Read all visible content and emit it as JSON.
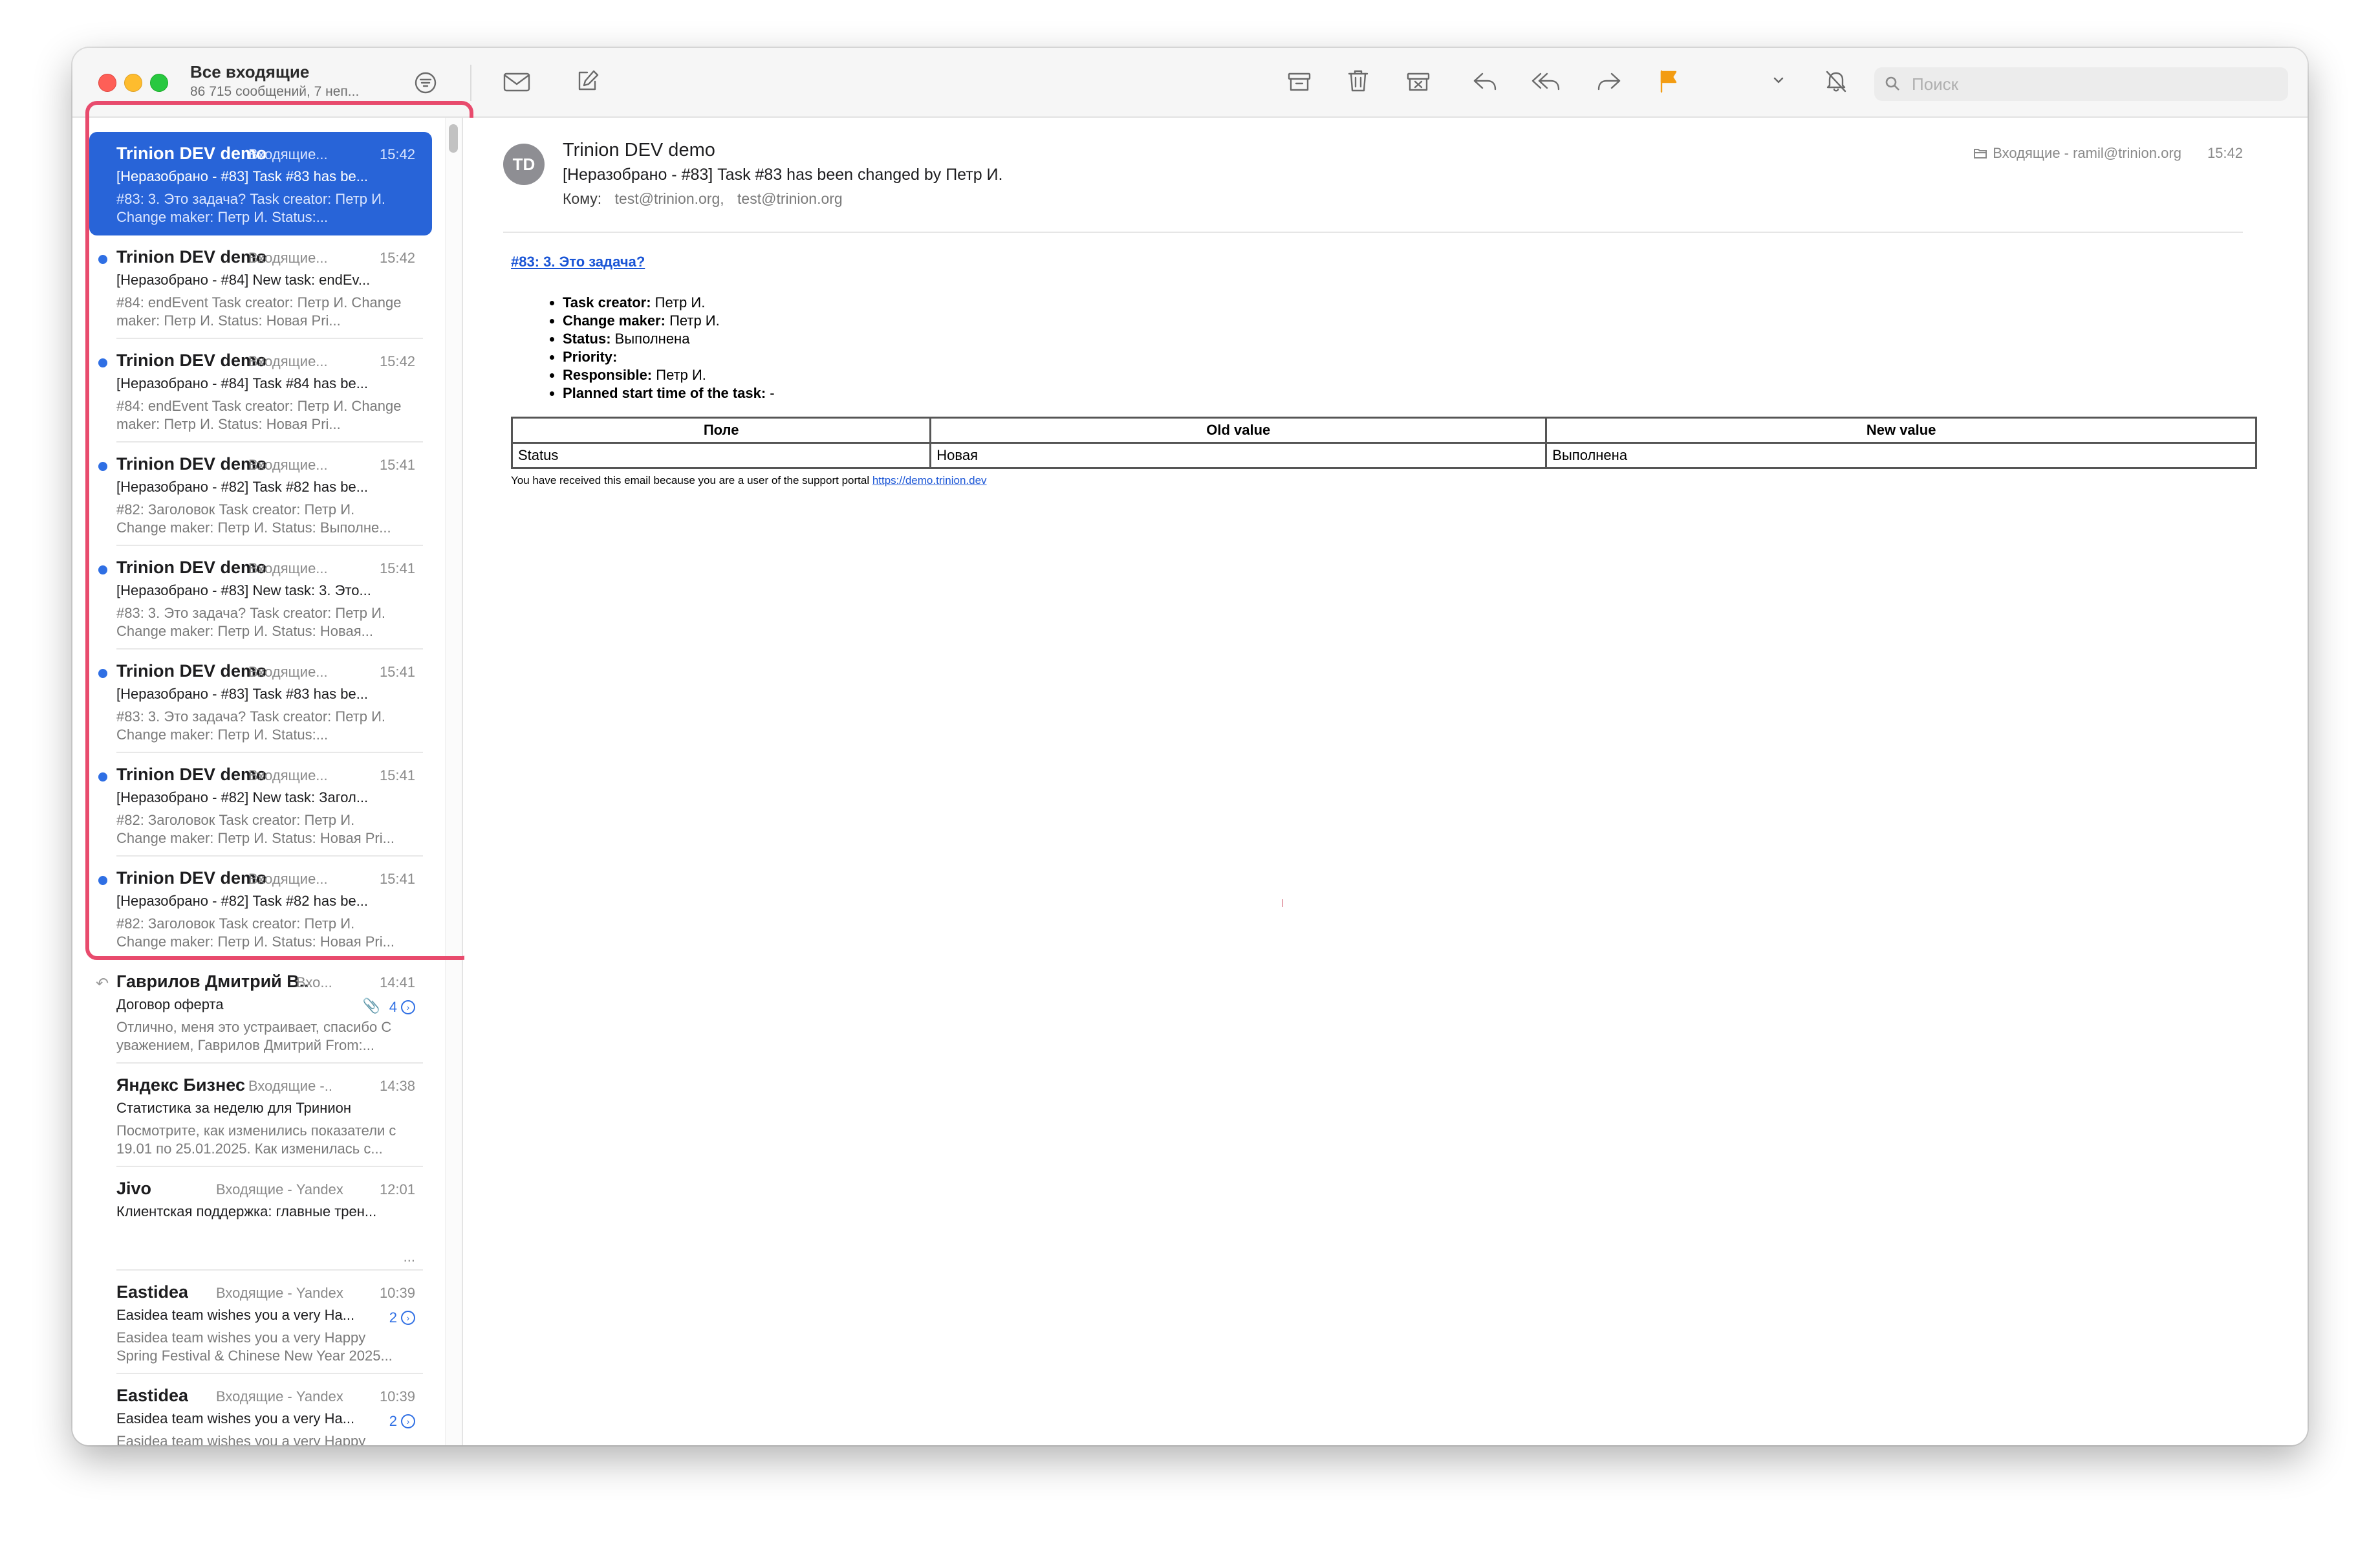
{
  "window": {
    "mailbox_title": "Все входящие",
    "mailbox_subtitle": "86 715 сообщений, 7 неп..."
  },
  "toolbar": {
    "icons": [
      "filter-icon",
      "envelope-icon",
      "compose-icon",
      "archive-icon",
      "trash-icon",
      "junk-icon",
      "reply-icon",
      "reply-all-icon",
      "forward-icon",
      "flag-icon",
      "mute-icon",
      "move-folder-icon",
      "search-icon"
    ],
    "flag_color": "#f39c12",
    "search_placeholder": "Поиск"
  },
  "messages": [
    {
      "from": "Trinion DEV demo",
      "mailbox": "Входящие...",
      "time": "15:42",
      "subject": "[Неразобрано -  #83] Task #83 has be...",
      "preview": "#83: 3. Это задача? Task creator: Петр И. Change maker: Петр И. Status:...",
      "unread": false,
      "selected": true
    },
    {
      "from": "Trinion DEV demo",
      "mailbox": "Входящие...",
      "time": "15:42",
      "subject": "[Неразобрано -  #84] New task: endEv...",
      "preview": "#84: endEvent Task creator: Петр И. Change maker: Петр И. Status: Новая Pri...",
      "unread": true,
      "selected": false
    },
    {
      "from": "Trinion DEV demo",
      "mailbox": "Входящие...",
      "time": "15:42",
      "subject": "[Неразобрано -  #84] Task #84 has be...",
      "preview": "#84: endEvent Task creator: Петр И. Change maker: Петр И. Status: Новая Pri...",
      "unread": true,
      "selected": false
    },
    {
      "from": "Trinion DEV demo",
      "mailbox": "Входящие...",
      "time": "15:41",
      "subject": "[Неразобрано -  #82] Task #82 has be...",
      "preview": "#82: Заголовок Task creator: Петр И. Change maker: Петр И. Status: Выполне...",
      "unread": true,
      "selected": false
    },
    {
      "from": "Trinion DEV demo",
      "mailbox": "Входящие...",
      "time": "15:41",
      "subject": "[Неразобрано -  #83] New task: 3. Это...",
      "preview": "#83: 3. Это задача? Task creator: Петр И. Change maker: Петр И. Status: Новая...",
      "unread": true,
      "selected": false
    },
    {
      "from": "Trinion DEV demo",
      "mailbox": "Входящие...",
      "time": "15:41",
      "subject": "[Неразобрано -  #83] Task #83 has be...",
      "preview": "#83: 3. Это задача? Task creator: Петр И. Change maker: Петр И. Status:...",
      "unread": true,
      "selected": false
    },
    {
      "from": "Trinion DEV demo",
      "mailbox": "Входящие...",
      "time": "15:41",
      "subject": "[Неразобрано -  #82] New task: Загол...",
      "preview": "#82: Заголовок Task creator: Петр И. Change maker: Петр И. Status: Новая Pri...",
      "unread": true,
      "selected": false
    },
    {
      "from": "Trinion DEV demo",
      "mailbox": "Входящие...",
      "time": "15:41",
      "subject": "[Неразобрано -  #82] Task #82 has be...",
      "preview": "#82: Заголовок Task creator: Петр И. Change maker: Петр И. Status: Новая Pri...",
      "unread": true,
      "selected": false
    },
    {
      "from": "Гаврилов Дмитрий В...",
      "mailbox": "Вхо...",
      "time": "14:41",
      "subject": "Договор оферта",
      "preview": "Отлично, меня это устраивает, спасибо С уважением, Гаврилов Дмитрий From:...",
      "unread": false,
      "selected": false,
      "replied": true,
      "attachment": true,
      "thread_count": "4"
    },
    {
      "from": "Яндекс Бизнес",
      "mailbox": "Входящие -...",
      "time": "14:38",
      "subject": "Статистика за неделю для Тринион",
      "preview": "Посмотрите, как изменились показатели с 19.01 по 25.01.2025. Как изменилась с...",
      "unread": false,
      "selected": false
    },
    {
      "from": "Jivo",
      "mailbox": "Входящие - Yandex",
      "time": "12:01",
      "subject": "Клиентская поддержка: главные трен...",
      "preview": "",
      "unread": false,
      "selected": false,
      "ellipsis": "..."
    },
    {
      "from": "Eastidea",
      "mailbox": "Входящие - Yandex",
      "time": "10:39",
      "subject": "Easidea team wishes you a very Ha...",
      "preview": "Easidea team wishes you a very Happy Spring Festival & Chinese New Year 2025...",
      "unread": false,
      "selected": false,
      "thread_count": "2"
    },
    {
      "from": "Eastidea",
      "mailbox": "Входящие - Yandex",
      "time": "10:39",
      "subject": "Easidea team wishes you a very Ha...",
      "preview": "Easidea team wishes you a very Happy",
      "unread": false,
      "selected": false,
      "thread_count": "2"
    }
  ],
  "reader": {
    "avatar_initials": "TD",
    "from": "Trinion DEV demo",
    "subject": "[Неразобрано -  #83] Task #83 has been changed by Петр И.",
    "to_label": "Кому:",
    "to_1": "test@trinion.org,",
    "to_2": "test@trinion.org",
    "mailbox": "Входящие - ramil@trinion.org",
    "time": "15:42",
    "task_link": "#83: 3. Это задача?",
    "fields": [
      {
        "label": "Task creator:",
        "value": " Петр И."
      },
      {
        "label": "Change maker:",
        "value": " Петр И."
      },
      {
        "label": "Status:",
        "value": " Выполнена"
      },
      {
        "label": "Priority:",
        "value": ""
      },
      {
        "label": "Responsible:",
        "value": " Петр И."
      },
      {
        "label": "Planned start time of the task:",
        "value": " -"
      }
    ],
    "table_headers": [
      "Поле",
      "Old value",
      "New value"
    ],
    "table_rows": [
      [
        "Status",
        "Новая",
        "Выполнена"
      ]
    ],
    "footer_text": "You have received this email because you are a user of the support portal ",
    "footer_link": "https://demo.trinion.dev"
  }
}
